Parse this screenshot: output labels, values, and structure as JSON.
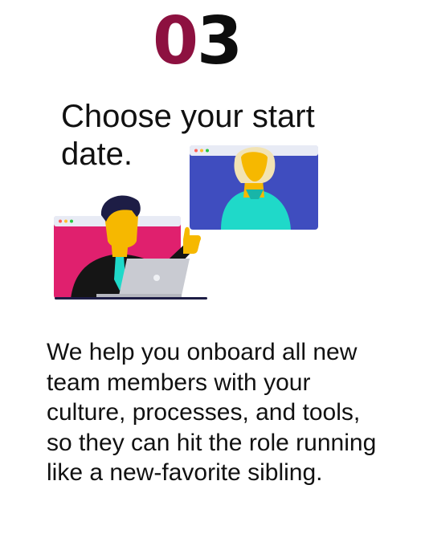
{
  "step": {
    "first_digit": "0",
    "second_digit": "3"
  },
  "heading": "Choose your start date.",
  "body": "We help you onboard all new team members with your culture, processes, and tools, so they can hit the role running like a new-favorite sibling.",
  "colors": {
    "accent": "#8d1140",
    "text": "#111111",
    "video_window_blue": "#3f4dbf",
    "video_window_pink": "#e0206e",
    "skin": "#f6b800",
    "teal": "#1fd9c9"
  },
  "illustration": {
    "description_icons": [
      "video-call-window-icon",
      "person-with-laptop-icon",
      "thumbs-up-icon"
    ]
  }
}
